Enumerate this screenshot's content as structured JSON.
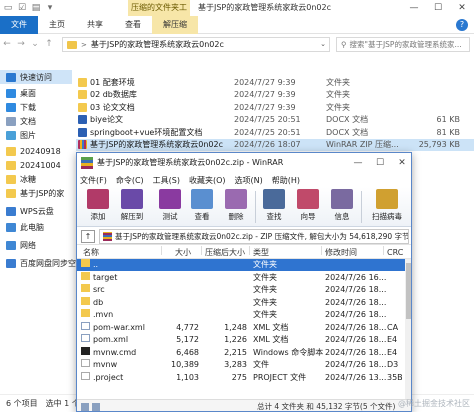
{
  "explorer": {
    "title": "基于JSP的家政管理系统家政云0n02c",
    "context_tab_header": "压缩的文件夹工具",
    "tabs": [
      "文件",
      "主页",
      "共享",
      "查看",
      "解压缩"
    ],
    "address": {
      "path": "基于JSP的家政管理系统家政云0n02c",
      "separator": ">"
    },
    "search": {
      "placeholder": "搜索\"基于JSP的家政管理系统家..."
    },
    "nav_items": [
      {
        "label": "快速访问",
        "icon": "star-icon",
        "color": "#2a78d0"
      },
      {
        "label": "桌面",
        "icon": "desktop-icon",
        "color": "#2f8ae0"
      },
      {
        "label": "下载",
        "icon": "download-icon",
        "color": "#2f8ae0"
      },
      {
        "label": "文档",
        "icon": "document-icon",
        "color": "#8aa0c0"
      },
      {
        "label": "图片",
        "icon": "picture-icon",
        "color": "#4aa0d8"
      },
      {
        "label": "20240918",
        "icon": "folder-icon",
        "color": "#f3c94e"
      },
      {
        "label": "20241004",
        "icon": "folder-icon",
        "color": "#f3c94e"
      },
      {
        "label": "冰糖",
        "icon": "folder-icon",
        "color": "#f3c94e"
      },
      {
        "label": "基于JSP的家",
        "icon": "folder-icon",
        "color": "#f3c94e"
      },
      {
        "label": "WPS云盘",
        "icon": "cloud-icon",
        "color": "#3a7cd0"
      },
      {
        "label": "此电脑",
        "icon": "computer-icon",
        "color": "#3f87d4"
      },
      {
        "label": "网络",
        "icon": "network-icon",
        "color": "#3f87d4"
      },
      {
        "label": "百度网盘同步空间",
        "icon": "baidu-cloud-icon",
        "color": "#3a7cd0"
      }
    ],
    "files": [
      {
        "name": "01 配套环境",
        "date": "2024/7/27 9:39",
        "type": "文件夹",
        "size": "",
        "icon": "folder"
      },
      {
        "name": "02 db数据库",
        "date": "2024/7/27 9:39",
        "type": "文件夹",
        "size": "",
        "icon": "folder"
      },
      {
        "name": "03 论文文档",
        "date": "2024/7/27 9:39",
        "type": "文件夹",
        "size": "",
        "icon": "folder"
      },
      {
        "name": "biye论文",
        "date": "2024/7/25 20:51",
        "type": "DOCX 文档",
        "size": "61 KB",
        "icon": "doc"
      },
      {
        "name": "springboot+vue环境配置文档",
        "date": "2024/7/25 20:51",
        "type": "DOCX 文档",
        "size": "81 KB",
        "icon": "doc"
      },
      {
        "name": "基于JSP的家政管理系统家政云0n02c",
        "date": "2024/7/26 18:07",
        "type": "WinRAR ZIP 压缩...",
        "size": "25,793 KB",
        "icon": "zip"
      }
    ],
    "status": {
      "count": "6 个项目",
      "selected": "选中 1 个项目"
    }
  },
  "winrar": {
    "title": "基于JSP的家政管理系统家政云0n02c.zip - WinRAR",
    "menu": [
      "文件(F)",
      "命令(C)",
      "工具(S)",
      "收藏夹(O)",
      "选项(N)",
      "帮助(H)"
    ],
    "toolbar": [
      {
        "label": "添加",
        "icon": "add-archive-icon",
        "color": "#b13a68"
      },
      {
        "label": "解压到",
        "icon": "extract-to-icon",
        "color": "#6a4aa8"
      },
      {
        "label": "测试",
        "icon": "test-icon",
        "color": "#8a3aa0"
      },
      {
        "label": "查看",
        "icon": "view-icon",
        "color": "#5a8fd0"
      },
      {
        "label": "删除",
        "icon": "delete-icon",
        "color": "#9a6ab0"
      },
      {
        "label": "查找",
        "icon": "find-icon",
        "color": "#4a6a9a"
      },
      {
        "label": "向导",
        "icon": "wizard-icon",
        "color": "#c04a6a"
      },
      {
        "label": "信息",
        "icon": "info-icon",
        "color": "#7a6aa0"
      },
      {
        "label": "扫描病毒",
        "icon": "virus-scan-icon",
        "color": "#d0a030"
      }
    ],
    "path": "基于JSP的家政管理系统家政云0n02c.zip - ZIP 压缩文件, 解包大小为 54,618,290 字节",
    "columns": [
      "名称",
      "大小",
      "压缩后大小",
      "类型",
      "修改时间",
      "CRC"
    ],
    "rows": [
      {
        "name": "..",
        "size": "",
        "packed": "",
        "type": "文件夹",
        "mtime": "",
        "crc": "",
        "icon": "folder"
      },
      {
        "name": "target",
        "size": "",
        "packed": "",
        "type": "文件夹",
        "mtime": "2024/7/26 16...",
        "crc": "",
        "icon": "folder"
      },
      {
        "name": "src",
        "size": "",
        "packed": "",
        "type": "文件夹",
        "mtime": "2024/7/26 18...",
        "crc": "",
        "icon": "folder"
      },
      {
        "name": "db",
        "size": "",
        "packed": "",
        "type": "文件夹",
        "mtime": "2024/7/26 18...",
        "crc": "",
        "icon": "folder"
      },
      {
        "name": ".mvn",
        "size": "",
        "packed": "",
        "type": "文件夹",
        "mtime": "2024/7/26 18...",
        "crc": "",
        "icon": "folder"
      },
      {
        "name": "pom-war.xml",
        "size": "4,772",
        "packed": "1,248",
        "type": "XML 文档",
        "mtime": "2024/7/26 18...",
        "crc": "CA",
        "icon": "xml"
      },
      {
        "name": "pom.xml",
        "size": "5,172",
        "packed": "1,226",
        "type": "XML 文档",
        "mtime": "2024/7/26 18...",
        "crc": "E4",
        "icon": "xml"
      },
      {
        "name": "mvnw.cmd",
        "size": "6,468",
        "packed": "2,215",
        "type": "Windows 命令脚本",
        "mtime": "2024/7/26 18...",
        "crc": "E4",
        "icon": "cmd"
      },
      {
        "name": "mvnw",
        "size": "10,389",
        "packed": "3,283",
        "type": "文件",
        "mtime": "2024/7/26 18...",
        "crc": "D3",
        "icon": "file"
      },
      {
        "name": ".project",
        "size": "1,103",
        "packed": "275",
        "type": "PROJECT 文件",
        "mtime": "2024/7/26 13...",
        "crc": "35B",
        "icon": "file"
      }
    ],
    "status": {
      "selected": "总计 4 文件夹 和 45,132 字节(5 个文件)"
    },
    "watermark": "@稀土掘金技术社区"
  }
}
